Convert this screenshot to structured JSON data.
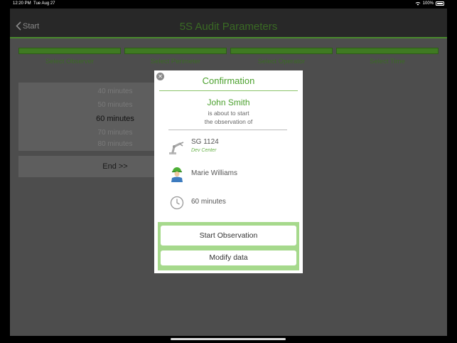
{
  "status": {
    "time": "12:20 PM",
    "date": "Tue Aug 27",
    "battery": "100%"
  },
  "nav": {
    "back_label": "Start",
    "title": "5S Audit Parameters"
  },
  "steps": [
    {
      "label": "Select Observer"
    },
    {
      "label": "Select Perimeter"
    },
    {
      "label": "Select Operator"
    },
    {
      "label": "Select Time"
    }
  ],
  "picker": {
    "options": [
      "40 minutes",
      "50 minutes",
      "60 minutes",
      "70 minutes",
      "80 minutes"
    ],
    "selected": "60 minutes"
  },
  "end_button": "End >>",
  "modal": {
    "title": "Confirmation",
    "observer_name": "John Smith",
    "line1": "is about to start",
    "line2": "the observation of",
    "perimeter": {
      "name": "SG 1124",
      "sub": "Dev Center",
      "icon": "robot-arm-icon"
    },
    "operator": {
      "name": "Marie Williams",
      "icon": "worker-icon"
    },
    "duration": {
      "value": "60 minutes",
      "icon": "clock-icon"
    },
    "start_label": "Start Observation",
    "modify_label": "Modify data"
  },
  "colors": {
    "accent": "#4aa02c",
    "button_area": "#a6d98c",
    "overlay": "#4d4d4d"
  }
}
